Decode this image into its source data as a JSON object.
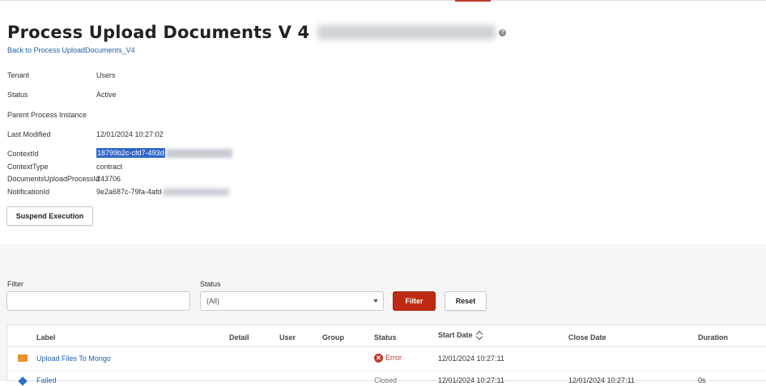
{
  "header": {
    "title": "Process Upload Documents V 4",
    "back_link": "Back to Process UploadDocuments_V4"
  },
  "properties": {
    "tenant": {
      "label": "Tenant",
      "value": "Users"
    },
    "status": {
      "label": "Status",
      "value": "Active"
    },
    "parent": {
      "label": "Parent Process Instance",
      "value": ""
    },
    "last_modified": {
      "label": "Last Modified",
      "value": "12/01/2024 10:27:02"
    },
    "context_id": {
      "label": "ContextId",
      "value": "18799b2c-cfd7-493d"
    },
    "context_type": {
      "label": "ContextType",
      "value": "contract"
    },
    "docs_upload": {
      "label": "DocumentsUploadProcessId",
      "value": "243706"
    },
    "notification": {
      "label": "NotificationId",
      "value": "9e2a687c-79fa-4afd"
    }
  },
  "actions": {
    "suspend": "Suspend Execution"
  },
  "filters": {
    "filter_label": "Filter",
    "filter_value": "",
    "status_label": "Status",
    "status_value": "(All)",
    "filter_button": "Filter",
    "reset_button": "Reset"
  },
  "table": {
    "columns": {
      "label": "Label",
      "detail": "Detail",
      "user": "User",
      "group": "Group",
      "status": "Status",
      "start": "Start Date",
      "close": "Close Date",
      "duration": "Duration"
    },
    "rows": [
      {
        "label": "Upload Files To Mongo",
        "status": "Error",
        "start": "12/01/2024 10:27:11",
        "close": "",
        "duration": ""
      },
      {
        "label": "Failed",
        "status": "Closed",
        "start": "12/01/2024 10:27:11",
        "close": "12/01/2024 10:27:11",
        "duration": "0s"
      }
    ]
  },
  "colors": {
    "accent": "#bf2a12",
    "link": "#1f5fa8",
    "selection": "#2f66c8",
    "error": "#c0392b",
    "task_icon": "#e8922c",
    "event_icon": "#2a6fc0"
  }
}
